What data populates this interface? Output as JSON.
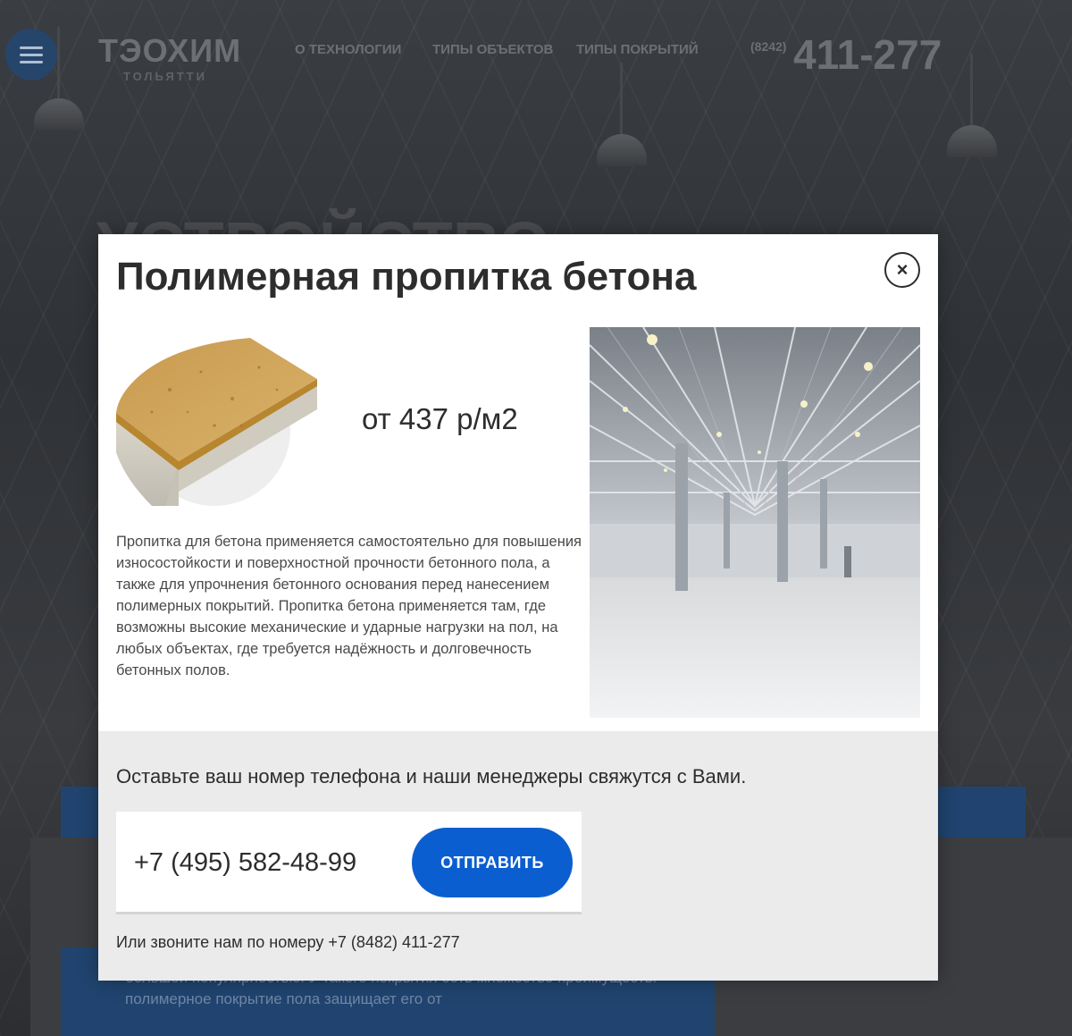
{
  "header": {
    "logo_main": "ТЭОХИМ",
    "logo_sub": "ТОЛЬЯТТИ",
    "nav": [
      "О ТЕХНОЛОГИИ",
      "ТИПЫ ОБЪЕКТОВ",
      "ТИПЫ ПОКРЫТИЙ"
    ],
    "phone_code": "(8242)",
    "phone_number": "411-277"
  },
  "background": {
    "hero_word": "УСТРОЙСТВО",
    "paragraph": "большой популярностью. У такого покрытия есть множество преимуществ: полимерное покрытие пола защищает его от"
  },
  "modal": {
    "title": "Полимерная пропитка бетона",
    "close_symbol": "×",
    "price": "от 437 р/м2",
    "description": "Пропитка для бетона применяется самостоятельно для повышения износостойкости и поверхностной прочности бетонного пола, а также для упрочнения бетонного основания перед нанесением полимерных покрытий. Пропитка бетона применяется там, где возможны высокие механические и ударные нагрузки на пол, на любых объектах, где требуется надёжность и долговечность бетонных полов.",
    "form": {
      "lead": "Оставьте ваш номер телефона и наши менеджеры свяжутся с Вами.",
      "phone_placeholder": "+7 (495) 582-48-99",
      "submit_label": "ОТПРАВИТЬ",
      "call_text": "Или звоните нам по номеру +7 (8482) 411-277"
    }
  },
  "colors": {
    "accent_blue": "#0b5ed0",
    "title_text": "#2d2d2d",
    "form_bg": "#ebebeb",
    "overlay_blue": "#20446f"
  },
  "icons": {
    "menu": "hamburger-icon",
    "close": "close-icon"
  }
}
